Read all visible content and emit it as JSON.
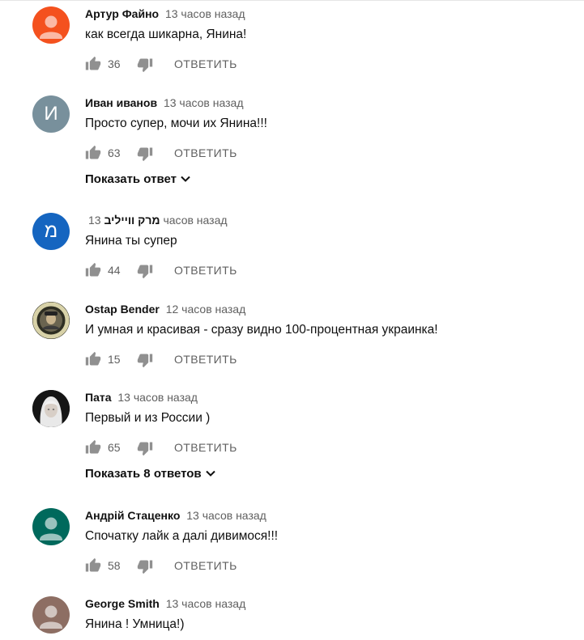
{
  "comments": [
    {
      "author": "Артур Файно",
      "time": "13 часов назад",
      "text": "как всегда шикарна, Янина!",
      "likes": "36",
      "reply_label": "ОТВЕТИТЬ",
      "avatar": {
        "type": "default-person",
        "bg": "#f4511e"
      }
    },
    {
      "author": "Иван иванов",
      "time": "13 часов назад",
      "text": "Просто супер, мочи их Янина!!!",
      "likes": "63",
      "reply_label": "ОТВЕТИТЬ",
      "avatar": {
        "type": "letter",
        "letter": "И",
        "bg": "#78909c"
      },
      "replies_toggle": "Показать ответ"
    },
    {
      "author": "מרק ווייליב",
      "time": "13 часов назад",
      "text": "Янина ты супер",
      "likes": "44",
      "reply_label": "ОТВЕТИТЬ",
      "avatar": {
        "type": "letter",
        "letter": "מ",
        "bg": "#1565c0"
      }
    },
    {
      "author": "Ostap Bender",
      "time": "12 часов назад",
      "text": "И умная и красивая - сразу видно 100-процентная украинка!",
      "likes": "15",
      "reply_label": "ОТВЕТИТЬ",
      "avatar": {
        "type": "photo-badge",
        "bg": "#3a3a2a"
      }
    },
    {
      "author": "Пата",
      "time": "13 часов назад",
      "text": "Первый и из России )",
      "likes": "65",
      "reply_label": "ОТВЕТИТЬ",
      "avatar": {
        "type": "photo-portrait",
        "bg": "#1a1a1a"
      },
      "replies_toggle": "Показать 8 ответов"
    },
    {
      "author": "Андрій Стаценко",
      "time": "13 часов назад",
      "text": "Спочатку лайк а далі дивимося!!!",
      "likes": "58",
      "reply_label": "ОТВЕТИТЬ",
      "avatar": {
        "type": "default-person",
        "bg": "#00695c"
      }
    },
    {
      "author": "George Smith",
      "time": "13 часов назад",
      "text": "Янина ! Умница!)",
      "avatar": {
        "type": "default-person",
        "bg": "#8d6e63"
      }
    }
  ]
}
